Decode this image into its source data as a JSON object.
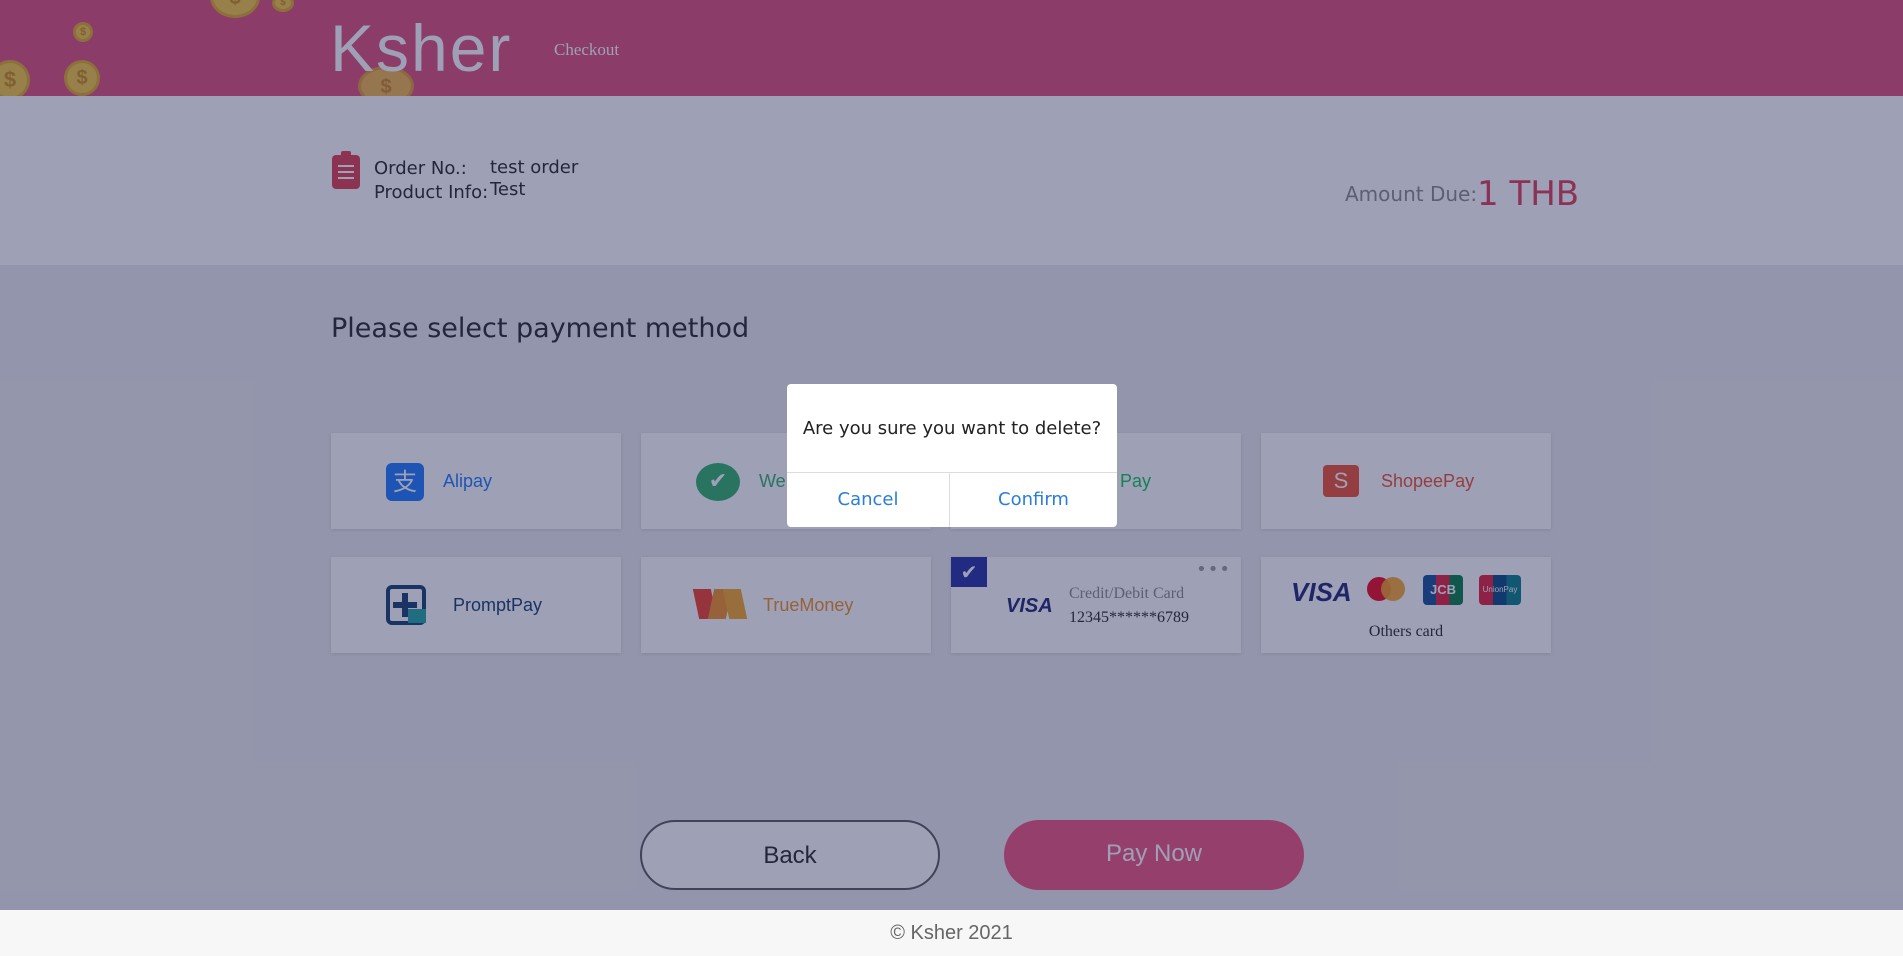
{
  "header": {
    "logo_text": "Ksher",
    "logo_sub": "Checkout"
  },
  "order": {
    "order_no_label": "Order No.:",
    "order_no_value": "test order",
    "product_info_label": "Product Info:",
    "product_info_value": "Test",
    "amount_label": "Amount Due:",
    "amount_value": "1 THB"
  },
  "main": {
    "section_title": "Please select payment method",
    "methods": [
      {
        "label": "Alipay",
        "icon": "alipay-icon",
        "color": "#1677ff"
      },
      {
        "label": "WeChat Pay",
        "visible_label": "We",
        "icon": "wechat-icon",
        "color": "#2aae67"
      },
      {
        "label": "Line Pay",
        "visible_label": "E Pay",
        "icon": "linepay-icon",
        "color": "#06c755"
      },
      {
        "label": "ShopeePay",
        "icon": "shopeepay-icon",
        "color": "#ee4d2d"
      },
      {
        "label": "PromptPay",
        "icon": "promptpay-icon",
        "color": "#0e3a6b"
      },
      {
        "label": "TrueMoney",
        "icon": "truemoney-icon",
        "color": "#f28c1e"
      }
    ],
    "saved_card": {
      "brand": "VISA",
      "label": "Credit/Debit Card",
      "number": "12345******6789",
      "selected": true
    },
    "others_card": {
      "label": "Others card",
      "brands": [
        "VISA",
        "mastercard",
        "JCB",
        "UnionPay"
      ]
    }
  },
  "actions": {
    "back_label": "Back",
    "pay_label": "Pay Now"
  },
  "footer": {
    "copyright": "© Ksher 2021"
  },
  "dialog": {
    "message": "Are you sure you want to delete?",
    "cancel_label": "Cancel",
    "confirm_label": "Confirm"
  },
  "colors": {
    "brand": "#dc4a75",
    "amount": "#dc3a55",
    "pay_button": "#ef4f7c",
    "dialog_link": "#2a7ed8"
  }
}
